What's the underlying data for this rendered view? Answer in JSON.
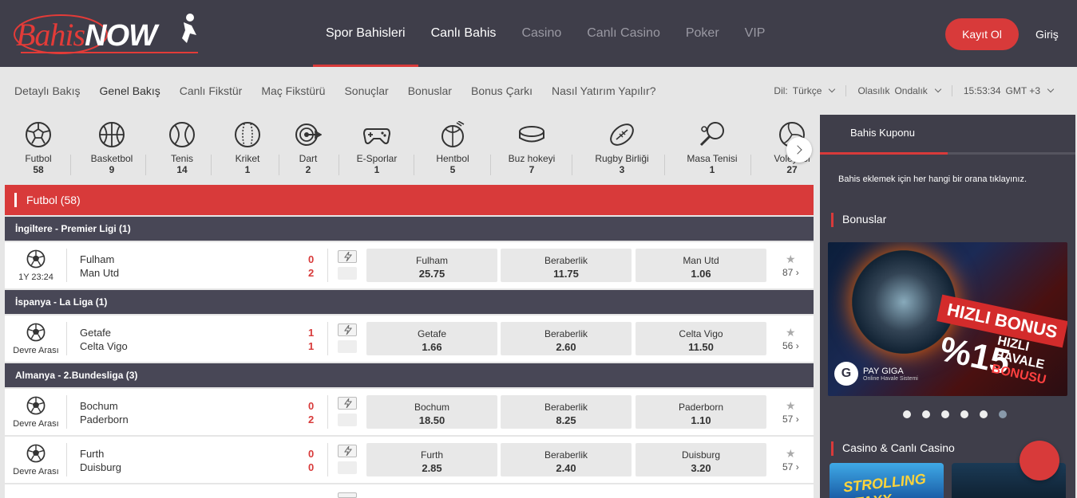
{
  "brand": {
    "name_part1": "Bahis",
    "name_part2": "NOW"
  },
  "mainnav": [
    "Spor Bahisleri",
    "Canlı Bahis",
    "Casino",
    "Canlı Casino",
    "Poker",
    "VIP"
  ],
  "auth": {
    "register": "Kayıt Ol",
    "login": "Giriş"
  },
  "subnav": [
    "Detaylı Bakış",
    "Genel Bakış",
    "Canlı Fikstür",
    "Maç Fikstürü",
    "Sonuçlar",
    "Bonuslar",
    "Bonus Çarkı",
    "Nasıl Yatırım Yapılır?"
  ],
  "settings": {
    "lang_label": "Dil:",
    "lang": "Türkçe",
    "odds_label": "Olasılık",
    "odds": "Ondalık",
    "time": "15:53:34",
    "tz": "GMT +3"
  },
  "sports": [
    {
      "name": "Futbol",
      "count": "58",
      "icon": "soccer-ball-icon"
    },
    {
      "name": "Basketbol",
      "count": "9",
      "icon": "basketball-icon"
    },
    {
      "name": "Tenis",
      "count": "14",
      "icon": "tennis-ball-icon"
    },
    {
      "name": "Kriket",
      "count": "1",
      "icon": "cricket-ball-icon"
    },
    {
      "name": "Dart",
      "count": "2",
      "icon": "dart-icon"
    },
    {
      "name": "E-Sporlar",
      "count": "1",
      "icon": "gamepad-icon"
    },
    {
      "name": "Hentbol",
      "count": "5",
      "icon": "handball-icon"
    },
    {
      "name": "Buz hokeyi",
      "count": "7",
      "icon": "hockey-puck-icon"
    },
    {
      "name": "Rugby Birliği",
      "count": "3",
      "icon": "rugby-ball-icon"
    },
    {
      "name": "Masa Tenisi",
      "count": "1",
      "icon": "table-tennis-icon"
    },
    {
      "name": "Voleybol",
      "count": "27",
      "icon": "volleyball-icon"
    }
  ],
  "section_title": "Futbol (58)",
  "leagues": [
    {
      "name": "İngiltere - Premier Ligi (1)"
    },
    {
      "name": "İspanya - La Liga (1)"
    },
    {
      "name": "Almanya - 2.Bundesliga (3)"
    }
  ],
  "matches": [
    {
      "time": "1Y 23:24",
      "team1": "Fulham",
      "team2": "Man Utd",
      "score1": "0",
      "score2": "2",
      "odds": [
        {
          "label": "Fulham",
          "value": "25.75"
        },
        {
          "label": "Beraberlik",
          "value": "11.75"
        },
        {
          "label": "Man Utd",
          "value": "1.06"
        }
      ],
      "more": "87"
    },
    {
      "time": "Devre Arası",
      "team1": "Getafe",
      "team2": "Celta Vigo",
      "score1": "1",
      "score2": "1",
      "odds": [
        {
          "label": "Getafe",
          "value": "1.66"
        },
        {
          "label": "Beraberlik",
          "value": "2.60"
        },
        {
          "label": "Celta Vigo",
          "value": "11.50"
        }
      ],
      "more": "56"
    },
    {
      "time": "Devre Arası",
      "team1": "Bochum",
      "team2": "Paderborn",
      "score1": "0",
      "score2": "2",
      "odds": [
        {
          "label": "Bochum",
          "value": "18.50"
        },
        {
          "label": "Beraberlik",
          "value": "8.25"
        },
        {
          "label": "Paderborn",
          "value": "1.10"
        }
      ],
      "more": "57"
    },
    {
      "time": "Devre Arası",
      "team1": "Furth",
      "team2": "Duisburg",
      "score1": "0",
      "score2": "0",
      "odds": [
        {
          "label": "Furth",
          "value": "2.85"
        },
        {
          "label": "Beraberlik",
          "value": "2.40"
        },
        {
          "label": "Duisburg",
          "value": "3.20"
        }
      ],
      "more": "57"
    }
  ],
  "sidebar": {
    "coupon_tab": "Bahis Kuponu",
    "coupon_msg": "Bahis eklemek için her hangi bir orana tıklayınız.",
    "bonus_title": "Bonuslar",
    "promo": {
      "line1": "HIZLI BONUS",
      "percent": "%15",
      "line2": "HIZLI",
      "line3": "HAVALE",
      "line4": "BONUSU",
      "brand": "PAY GIGA",
      "brand_sub": "Online Havale Sistemi"
    },
    "casino_title": "Casino & Canlı Casino",
    "game1": "STROLLING STAXX"
  },
  "colors": {
    "accent": "#d83a3a",
    "header": "#3f3e4a",
    "league": "#484756"
  }
}
